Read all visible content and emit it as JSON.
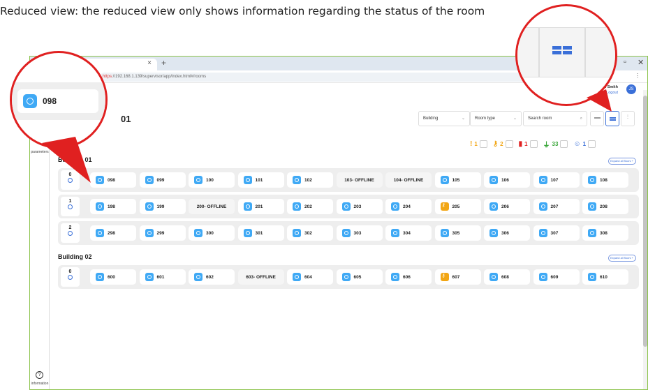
{
  "caption": "Reduced view: the reduced view only shows information regarding the status of the room",
  "browser": {
    "tab_close": "×",
    "new_tab": "+",
    "url_scheme": "https",
    "url_rest": "://192.168.1.139/supervisor/app/index.html#/rooms",
    "minimize": "–",
    "restore": "▫",
    "close": "✕",
    "menu": "⋮"
  },
  "user": {
    "name": "llon Smith",
    "logout": "Logout",
    "initials": "JS"
  },
  "sidebar": {
    "parameters_label": "parameters",
    "information_label": "information",
    "information_icon": "?"
  },
  "page_title": "01",
  "filters": {
    "building": "Building",
    "room_type": "Room type",
    "search": "Search room",
    "caret": "⌄"
  },
  "counters": [
    {
      "icon": "alert-icon",
      "glyph": "!",
      "value": "1",
      "color": "#f2a614"
    },
    {
      "icon": "key-icon",
      "glyph": "⚷",
      "value": "2",
      "color": "#f2a614"
    },
    {
      "icon": "battery-icon",
      "glyph": "▮",
      "value": "1",
      "color": "#e02020"
    },
    {
      "icon": "plug-icon",
      "glyph": "⏚",
      "value": "33",
      "color": "#3aa63a"
    },
    {
      "icon": "user-icon",
      "glyph": "☺",
      "value": "1",
      "color": "#3a6fd8"
    }
  ],
  "expand_label": "Expand all floors",
  "buildings": [
    {
      "name": "Building 01",
      "floors": [
        {
          "number": "0",
          "rooms": [
            {
              "label": "098",
              "state": "ok"
            },
            {
              "label": "099",
              "state": "ok"
            },
            {
              "label": "100",
              "state": "ok"
            },
            {
              "label": "101",
              "state": "ok"
            },
            {
              "label": "102",
              "state": "ok"
            },
            {
              "label": "103- OFFLINE",
              "state": "offline"
            },
            {
              "label": "104- OFFLINE",
              "state": "offline"
            },
            {
              "label": "105",
              "state": "ok"
            },
            {
              "label": "106",
              "state": "ok"
            },
            {
              "label": "107",
              "state": "ok"
            },
            {
              "label": "108",
              "state": "ok"
            }
          ]
        },
        {
          "number": "1",
          "rooms": [
            {
              "label": "198",
              "state": "ok"
            },
            {
              "label": "199",
              "state": "ok"
            },
            {
              "label": "200- OFFLINE",
              "state": "offline"
            },
            {
              "label": "201",
              "state": "ok"
            },
            {
              "label": "202",
              "state": "ok"
            },
            {
              "label": "203",
              "state": "ok"
            },
            {
              "label": "204",
              "state": "ok"
            },
            {
              "label": "205",
              "state": "key"
            },
            {
              "label": "206",
              "state": "ok"
            },
            {
              "label": "207",
              "state": "ok"
            },
            {
              "label": "208",
              "state": "ok"
            }
          ]
        },
        {
          "number": "2",
          "rooms": [
            {
              "label": "298",
              "state": "ok"
            },
            {
              "label": "299",
              "state": "ok"
            },
            {
              "label": "300",
              "state": "ok"
            },
            {
              "label": "301",
              "state": "ok"
            },
            {
              "label": "302",
              "state": "ok"
            },
            {
              "label": "303",
              "state": "ok"
            },
            {
              "label": "304",
              "state": "ok"
            },
            {
              "label": "305",
              "state": "ok"
            },
            {
              "label": "306",
              "state": "ok"
            },
            {
              "label": "307",
              "state": "ok"
            },
            {
              "label": "308",
              "state": "ok"
            }
          ]
        }
      ]
    },
    {
      "name": "Building 02",
      "floors": [
        {
          "number": "0",
          "rooms": [
            {
              "label": "600",
              "state": "ok"
            },
            {
              "label": "601",
              "state": "ok"
            },
            {
              "label": "602",
              "state": "ok"
            },
            {
              "label": "603- OFFLINE",
              "state": "offline"
            },
            {
              "label": "604",
              "state": "ok"
            },
            {
              "label": "605",
              "state": "ok"
            },
            {
              "label": "606",
              "state": "ok"
            },
            {
              "label": "607",
              "state": "key"
            },
            {
              "label": "608",
              "state": "ok"
            },
            {
              "label": "609",
              "state": "ok"
            },
            {
              "label": "610",
              "state": "ok"
            }
          ]
        }
      ]
    }
  ],
  "zoom_left_room": "098"
}
